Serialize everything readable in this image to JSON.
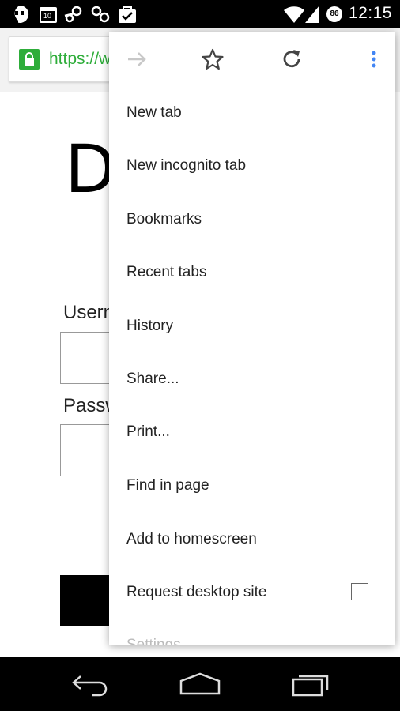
{
  "status_bar": {
    "time": "12:15",
    "battery_percent": "86",
    "icons": [
      "hangouts-icon",
      "calendar-icon",
      "steam-icon",
      "usb-icon",
      "shopping-bag-icon",
      "wifi-icon",
      "signal-icon",
      "battery-icon"
    ],
    "calendar_day": "10"
  },
  "toolbar": {
    "url_text": "https://w"
  },
  "page": {
    "heading": "D",
    "username_label": "Usern",
    "password_label": "Passw"
  },
  "menu": {
    "icons": [
      "forward-icon",
      "star-icon",
      "reload-icon",
      "more-vert-icon"
    ],
    "items": [
      {
        "label": "New tab"
      },
      {
        "label": "New incognito tab"
      },
      {
        "label": "Bookmarks"
      },
      {
        "label": "Recent tabs"
      },
      {
        "label": "History"
      },
      {
        "label": "Share..."
      },
      {
        "label": "Print..."
      },
      {
        "label": "Find in page"
      },
      {
        "label": "Add to homescreen"
      },
      {
        "label": "Request desktop site"
      },
      {
        "label": "Settings"
      }
    ],
    "request_desktop_checked": false
  },
  "colors": {
    "secure_green": "#2ead3a",
    "menu_accent_blue": "#4285f4"
  }
}
